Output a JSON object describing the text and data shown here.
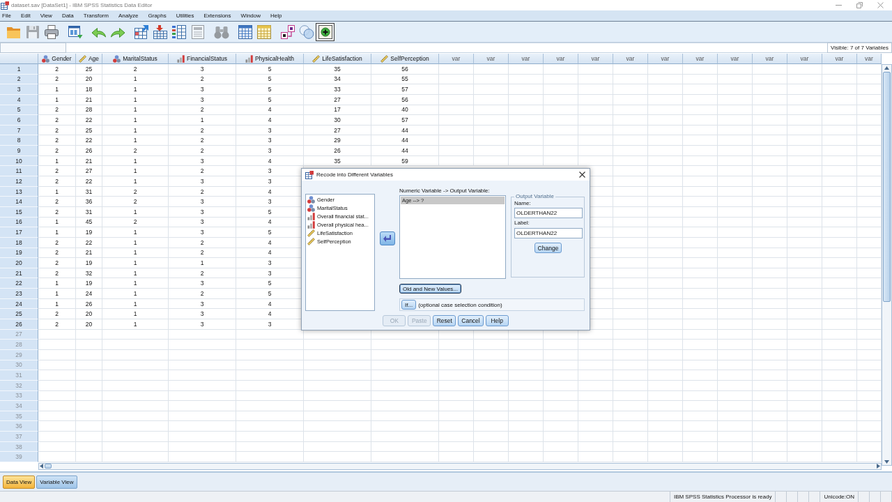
{
  "window": {
    "title": "dataset.sav [DataSet1] - IBM SPSS Statistics Data Editor"
  },
  "menu": [
    "File",
    "Edit",
    "View",
    "Data",
    "Transform",
    "Analyze",
    "Graphs",
    "Utilities",
    "Extensions",
    "Window",
    "Help"
  ],
  "toolbar": [
    [
      {
        "kind": "folder",
        "disabled": false,
        "highlighted": false
      },
      {
        "kind": "disk",
        "disabled": true,
        "highlighted": false
      },
      {
        "kind": "printer",
        "disabled": false,
        "highlighted": false
      }
    ],
    [
      {
        "kind": "window",
        "disabled": false,
        "highlighted": false
      }
    ],
    [
      {
        "kind": "undo",
        "disabled": false,
        "highlighted": false
      },
      {
        "kind": "redo",
        "disabled": false,
        "highlighted": false
      }
    ],
    [
      {
        "kind": "gotocase",
        "disabled": false,
        "highlighted": false
      },
      {
        "kind": "gotovar",
        "disabled": false,
        "highlighted": false
      },
      {
        "kind": "variables",
        "disabled": false,
        "highlighted": false
      },
      {
        "kind": "report",
        "disabled": true,
        "highlighted": false
      }
    ],
    [
      {
        "kind": "binoculars",
        "disabled": true,
        "highlighted": false
      }
    ],
    [
      {
        "kind": "bluetable",
        "disabled": false,
        "highlighted": false
      },
      {
        "kind": "yellowtable",
        "disabled": false,
        "highlighted": false
      }
    ],
    [
      {
        "kind": "labels",
        "disabled": false,
        "highlighted": false
      },
      {
        "kind": "circles",
        "disabled": false,
        "highlighted": false
      },
      {
        "kind": "plus",
        "disabled": false,
        "highlighted": true
      }
    ]
  ],
  "cell_editor": {
    "visible_count": "Visible: 7 of 7 Variables"
  },
  "data_grid": {
    "columns": [
      {
        "label": "Gender",
        "kind": "nominal"
      },
      {
        "label": "Age",
        "kind": "scale"
      },
      {
        "label": "MaritalStatus",
        "kind": "nominal"
      },
      {
        "label": "FinancialStatus",
        "kind": "ordinal"
      },
      {
        "label": "PhysicalHealth",
        "kind": "ordinal"
      },
      {
        "label": "LifeSatisfaction",
        "kind": "scale"
      },
      {
        "label": "SelfPerception",
        "kind": "scale"
      },
      {
        "label": "var",
        "kind": "empty"
      },
      {
        "label": "var",
        "kind": "empty"
      },
      {
        "label": "var",
        "kind": "empty"
      },
      {
        "label": "var",
        "kind": "empty"
      },
      {
        "label": "var",
        "kind": "empty"
      },
      {
        "label": "var",
        "kind": "empty"
      },
      {
        "label": "var",
        "kind": "empty"
      },
      {
        "label": "var",
        "kind": "empty"
      },
      {
        "label": "var",
        "kind": "empty"
      },
      {
        "label": "var",
        "kind": "empty"
      },
      {
        "label": "var",
        "kind": "empty"
      },
      {
        "label": "var",
        "kind": "empty"
      },
      {
        "label": "var",
        "kind": "empty"
      }
    ],
    "rows": [
      {
        "number": "1",
        "cells": [
          "2",
          "25",
          "2",
          "3",
          "5",
          "35",
          "56"
        ]
      },
      {
        "number": "2",
        "cells": [
          "2",
          "20",
          "1",
          "2",
          "5",
          "34",
          "55"
        ]
      },
      {
        "number": "3",
        "cells": [
          "1",
          "18",
          "1",
          "3",
          "5",
          "33",
          "57"
        ]
      },
      {
        "number": "4",
        "cells": [
          "1",
          "21",
          "1",
          "3",
          "5",
          "27",
          "56"
        ]
      },
      {
        "number": "5",
        "cells": [
          "2",
          "28",
          "1",
          "2",
          "4",
          "17",
          "40"
        ]
      },
      {
        "number": "6",
        "cells": [
          "2",
          "22",
          "1",
          "1",
          "4",
          "30",
          "57"
        ]
      },
      {
        "number": "7",
        "cells": [
          "2",
          "25",
          "1",
          "2",
          "3",
          "27",
          "44"
        ]
      },
      {
        "number": "8",
        "cells": [
          "2",
          "22",
          "1",
          "2",
          "3",
          "29",
          "44"
        ]
      },
      {
        "number": "9",
        "cells": [
          "2",
          "26",
          "2",
          "2",
          "3",
          "26",
          "44"
        ]
      },
      {
        "number": "10",
        "cells": [
          "1",
          "21",
          "1",
          "3",
          "4",
          "35",
          "59"
        ]
      },
      {
        "number": "11",
        "cells": [
          "2",
          "27",
          "1",
          "2",
          "3"
        ]
      },
      {
        "number": "12",
        "cells": [
          "2",
          "22",
          "1",
          "3",
          "3"
        ]
      },
      {
        "number": "13",
        "cells": [
          "1",
          "31",
          "2",
          "2",
          "4"
        ]
      },
      {
        "number": "14",
        "cells": [
          "2",
          "36",
          "2",
          "3",
          "3"
        ]
      },
      {
        "number": "15",
        "cells": [
          "2",
          "31",
          "1",
          "3",
          "5"
        ]
      },
      {
        "number": "16",
        "cells": [
          "1",
          "45",
          "2",
          "3",
          "4"
        ]
      },
      {
        "number": "17",
        "cells": [
          "1",
          "19",
          "1",
          "3",
          "5"
        ]
      },
      {
        "number": "18",
        "cells": [
          "2",
          "22",
          "1",
          "2",
          "4"
        ]
      },
      {
        "number": "19",
        "cells": [
          "2",
          "21",
          "1",
          "2",
          "4"
        ]
      },
      {
        "number": "20",
        "cells": [
          "2",
          "19",
          "1",
          "1",
          "3"
        ]
      },
      {
        "number": "21",
        "cells": [
          "2",
          "32",
          "1",
          "2",
          "3"
        ]
      },
      {
        "number": "22",
        "cells": [
          "1",
          "19",
          "1",
          "3",
          "5"
        ]
      },
      {
        "number": "23",
        "cells": [
          "1",
          "24",
          "1",
          "2",
          "5"
        ]
      },
      {
        "number": "24",
        "cells": [
          "1",
          "26",
          "1",
          "3",
          "4"
        ]
      },
      {
        "number": "25",
        "cells": [
          "2",
          "20",
          "1",
          "3",
          "4"
        ]
      },
      {
        "number": "26",
        "cells": [
          "2",
          "20",
          "1",
          "3",
          "3"
        ]
      },
      {
        "number": "27",
        "cells": []
      },
      {
        "number": "28",
        "cells": []
      },
      {
        "number": "29",
        "cells": []
      },
      {
        "number": "30",
        "cells": []
      },
      {
        "number": "31",
        "cells": []
      },
      {
        "number": "32",
        "cells": []
      },
      {
        "number": "33",
        "cells": []
      },
      {
        "number": "34",
        "cells": []
      },
      {
        "number": "35",
        "cells": []
      },
      {
        "number": "36",
        "cells": []
      },
      {
        "number": "37",
        "cells": []
      },
      {
        "number": "38",
        "cells": []
      },
      {
        "number": "39",
        "cells": []
      }
    ]
  },
  "tabs": [
    {
      "label": "Data View",
      "selected": true
    },
    {
      "label": "Variable View",
      "selected": false
    }
  ],
  "status_bar": {
    "message": "IBM SPSS Statistics Processor is ready",
    "encoding": "Unicode:ON"
  },
  "dialog": {
    "title": "Recode into Different Variables",
    "variables": [
      {
        "label": "Gender",
        "kind": "nominal",
        "selected": false
      },
      {
        "label": "MaritalStatus",
        "kind": "nominal",
        "selected": false
      },
      {
        "label": "Overall financial stat...",
        "kind": "ordinal",
        "selected": false
      },
      {
        "label": "Overall physical hea...",
        "kind": "ordinal",
        "selected": false
      },
      {
        "label": "LifeSatisfaction",
        "kind": "scale",
        "selected": false
      },
      {
        "label": "SelfPerception",
        "kind": "scale",
        "selected": false
      }
    ],
    "mapping_label": "Numeric Variable -> Output Variable:",
    "mappings": [
      {
        "label": "Age --> ?",
        "selected": true
      }
    ],
    "output": {
      "title": "Output Variable",
      "name_label": "Name:",
      "name": "OLDERTHAN22",
      "label_label": "Label:",
      "label": "OLDERTHAN22",
      "change_button": "Change"
    },
    "old_new_button": {
      "label": "Old and New Values...",
      "focused": true
    },
    "if_button": "If...",
    "if_note": "(optional case selection condition)",
    "buttons": [
      {
        "label": "OK",
        "disabled": true
      },
      {
        "label": "Paste",
        "disabled": true
      },
      {
        "label": "Reset",
        "disabled": false
      },
      {
        "label": "Cancel",
        "disabled": false
      },
      {
        "label": "Help",
        "disabled": false
      }
    ]
  }
}
